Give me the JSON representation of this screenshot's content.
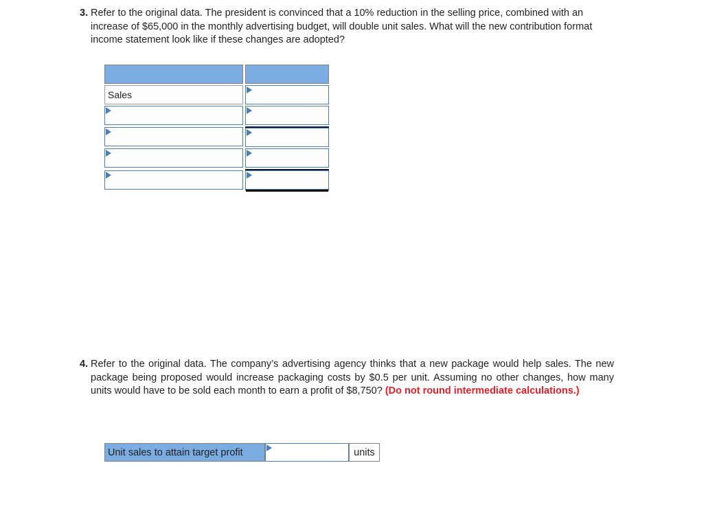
{
  "questions": [
    {
      "number": "3.",
      "text_part1": "Refer to the original data. The president is convinced that a 10% reduction in the selling price, combined with an increase of $65,000 in the monthly advertising budget, will double unit sales. What will the new contribution format income statement look like if these changes are adopted?",
      "emphasis": ""
    },
    {
      "number": "4.",
      "text_part1": "Refer to the original data. The company’s advertising agency thinks that a new package would help sales. The new package being proposed would increase packaging costs by $0.5 per unit. Assuming no other changes, how many units would have to be sold each month to earn a profit of $8,750? ",
      "emphasis": "(Do not round intermediate calculations.)"
    }
  ],
  "income_statement_table": {
    "header": {
      "label_col": "",
      "value_col": ""
    },
    "rows": [
      {
        "label": "Sales",
        "label_is_dropdown": false,
        "value": "",
        "value_rule_top": false,
        "value_rule_bottom_double": false
      },
      {
        "label": "",
        "label_is_dropdown": true,
        "value": "",
        "value_rule_top": false,
        "value_rule_bottom_double": false
      },
      {
        "label": "",
        "label_is_dropdown": true,
        "value": "",
        "value_rule_top": true,
        "value_rule_bottom_double": false
      },
      {
        "label": "",
        "label_is_dropdown": true,
        "value": "",
        "value_rule_top": false,
        "value_rule_bottom_double": false
      },
      {
        "label": "",
        "label_is_dropdown": true,
        "value": "",
        "value_rule_top": true,
        "value_rule_bottom_double": true
      }
    ]
  },
  "target_profit_answer": {
    "label": "Unit sales to attain target profit",
    "value": "",
    "units": "units"
  },
  "colors": {
    "header_blue": "#7BADE2",
    "control_border_blue": "#4A7EBB",
    "emphasis_red": "#EE1C25",
    "rule_dark": "#0B1A3A"
  }
}
